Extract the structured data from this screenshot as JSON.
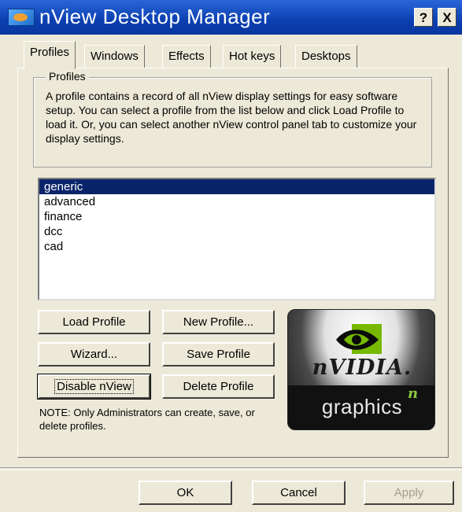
{
  "window": {
    "title": "nView Desktop Manager",
    "help_label": "?",
    "close_label": "X"
  },
  "tabs": [
    {
      "label": "Profiles",
      "active": true
    },
    {
      "label": "Windows",
      "active": false
    },
    {
      "label": "Effects",
      "active": false
    },
    {
      "label": "Hot keys",
      "active": false
    },
    {
      "label": "Desktops",
      "active": false
    }
  ],
  "profiles_group": {
    "legend": "Profiles",
    "description": "A profile contains a record of all nView display settings for easy software setup. You can select a profile from the list below and click Load Profile to load it. Or, you can select another nView control panel tab to customize your display settings."
  },
  "profile_list": {
    "items": [
      "generic",
      "advanced",
      "finance",
      "dcc",
      "cad"
    ],
    "selected": "generic"
  },
  "buttons": {
    "load_profile": "Load Profile",
    "new_profile": "New Profile...",
    "wizard": "Wizard...",
    "save_profile": "Save Profile",
    "disable_nview": "Disable nView",
    "delete_profile": "Delete Profile"
  },
  "note": "NOTE: Only Administrators can create, save, or delete profiles.",
  "logo": {
    "brand": "nVIDIA.",
    "product": "graphics",
    "superscript": "n"
  },
  "dialog_buttons": {
    "ok": "OK",
    "cancel": "Cancel",
    "apply": "Apply"
  },
  "colors": {
    "title_bar": "#0b3fb0",
    "selection": "#0a246a",
    "dialog_bg": "#ece9d8",
    "nvidia_green": "#76b900"
  }
}
